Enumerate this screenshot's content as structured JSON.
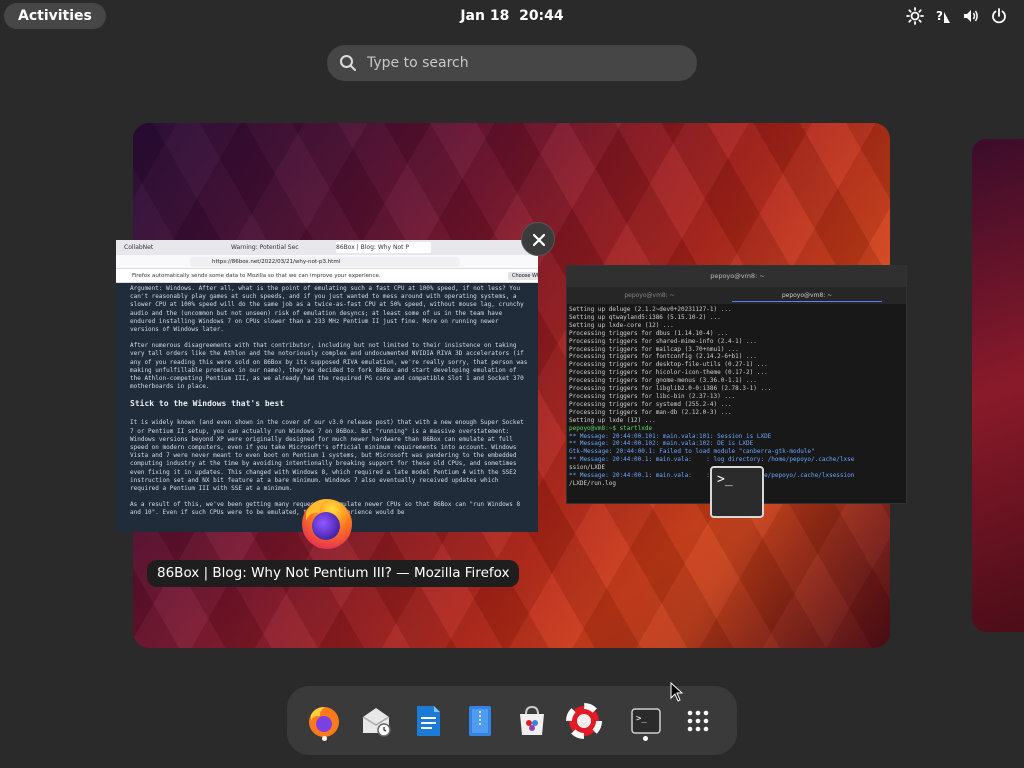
{
  "topbar": {
    "activities": "Activities",
    "clock": "Jan 18  20:44",
    "tray": [
      "brightness-icon",
      "accessibility-icon",
      "volume-icon",
      "power-icon"
    ]
  },
  "search": {
    "placeholder": "Type to search"
  },
  "firefox": {
    "tabs": [
      "CollabNet",
      "Warning: Potential Sec",
      "86Box | Blog: Why Not P"
    ],
    "url": "https://86box.net/2022/03/21/why-not-p3.html",
    "notice": "Firefox automatically sends some data to Mozilla so that we can improve your experience.",
    "notice_button": "Choose What I Share",
    "paragraphs": [
      "Argument: Windows. After all, what is the point of emulating such a fast CPU at 100% speed, if not less? You can't reasonably play games at such speeds, and if you just wanted to mess around with operating systems, a slower CPU at 100% speed will do the same job as a twice-as-fast CPU at 50% speed, without mouse lag, crunchy audio and the (uncommon but not unseen) risk of emulation desyncs; at least some of us in the team have endured installing Windows 7 on CPUs slower than a 233 MHz Pentium II just fine. More on running newer versions of Windows later.",
      "After numerous disagreements with that contributor, including but not limited to their insistence on taking very tall orders like the Athlon and the notoriously complex and undocumented NVIDIA RIVA 3D accelerators (if any of you reading this were sold on 86Box by its supposed RIVA emulation, we're really sorry, that person was making unfulfillable promises in our name), they've decided to fork 86Box and start developing emulation of the Athlon-competing Pentium III, as we already had the required PG core and compatible Slot 1 and Socket 370 motherboards in place."
    ],
    "heading": "Stick to the Windows that's best",
    "paragraphs2": [
      "It is widely known (and even shown in the cover of our v3.0 release post) that with a new enough Super Socket 7 or Pentium II setup, you can actually run Windows 7 on 86Box. But \"running\" is a massive overstatement: Windows versions beyond XP were originally designed for much newer hardware than 86Box can emulate at full speed on modern computers, even if you take Microsoft's official minimum requirements into account. Windows Vista and 7 were never meant to even boot on Pentium 1 systems, but Microsoft was pandering to the embedded computing industry at the time by avoiding intentionally breaking support for these old CPUs, and sometimes even fixing it in updates. This changed with Windows 8, which required a late model Pentium 4 with the SSE2 instruction set and NX bit feature at a bare minimum. Windows 7 also eventually received updates which required a Pentium III with SSE at a minimum.",
      "As a result of this, we've been getting many requests to emulate newer CPUs so that 86Box can \"run Windows 8 and 10\". Even if such CPUs were to be emulated, the user experience would be"
    ],
    "window_title": "86Box | Blog: Why Not Pentium III? — Mozilla Firefox"
  },
  "terminal": {
    "title": "pepoyo@vm8: ~",
    "tabs": [
      "pepoyo@vm8: ~",
      "pepoyo@vm8: ~"
    ],
    "lines": [
      "Setting up deluge (2.1.2~dev0+20231127-1) ...",
      "Setting up qtwayland5:i386 (5.15.10-2) ...",
      "Setting up lxde-core (12) ...",
      "Processing triggers for dbus (1.14.10-4) ...",
      "Processing triggers for shared-mime-info (2.4-1) ...",
      "Processing triggers for mailcap (3.70+nmu1) ...",
      "Processing triggers for fontconfig (2.14.2-6+b1) ...",
      "Processing triggers for desktop-file-utils (0.27-1) ...",
      "Processing triggers for hicolor-icon-theme (0.17-2) ...",
      "Processing triggers for gnome-menus (3.36.0-1.1) ...",
      "Processing triggers for libglib2.0-0:i386 (2.78.3-1) ...",
      "Processing triggers for libc-bin (2.37-13) ...",
      "Processing triggers for systemd (255.2-4) ...",
      "Processing triggers for man-db (2.12.0-3) ...",
      "Setting up lxde (12) ...",
      "pepoyo@vm8:~$ startlxde",
      "** Message: 20:44:00.101: main.vala:101: Session is LXDE",
      "** Message: 20:44:00.102: main.vala:102: DE is LXDE",
      "Gtk-Message: 20:44:00.1: Failed to load module \"canberra-gtk-module\"",
      "** Message: 20:44:00.1: main.vala:    : log directory: /home/pepoyo/.cache/lxse",
      "ssion/LXDE",
      "** Message: 20:44:00.1: main.vala:    : log path: /home/pepoyo/.cache/lxsession",
      "/LXDE/run.log"
    ]
  },
  "dock": {
    "items": [
      "firefox-icon",
      "evolution-icon",
      "writer-icon",
      "text-editor-icon",
      "software-icon",
      "help-icon",
      "terminal-icon",
      "app-grid-icon"
    ]
  }
}
